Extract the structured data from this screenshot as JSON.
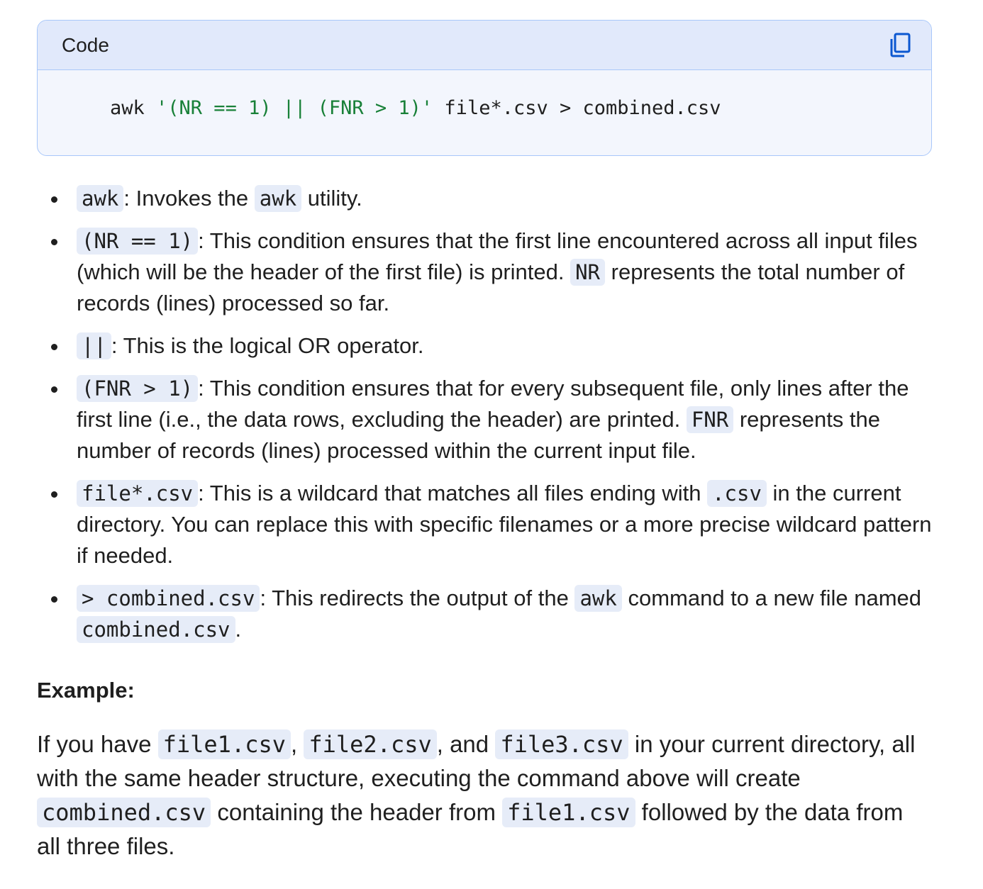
{
  "code_block": {
    "language_label": "Code",
    "copy_icon": "copy-icon",
    "code_prefix": "awk ",
    "code_string": "'(NR == 1) || (FNR > 1)'",
    "code_suffix": " file*.csv > combined.csv"
  },
  "bullets": [
    {
      "code": "awk",
      "text_1": ": Invokes the ",
      "code_2": "awk",
      "text_2": " utility."
    },
    {
      "code": "(NR == 1)",
      "text_1": ": This condition ensures that the first line encountered across all input files (which will be the header of the first file) is printed. ",
      "code_2": "NR",
      "text_2": " represents the total number of records (lines) processed so far."
    },
    {
      "code": "||",
      "text_1": ": This is the logical OR operator."
    },
    {
      "code": "(FNR > 1)",
      "text_1": ": This condition ensures that for every subsequent file, only lines after the first line (i.e., the data rows, excluding the header) are printed. ",
      "code_2": "FNR",
      "text_2": " represents the number of records (lines) processed within the current input file."
    },
    {
      "code": "file*.csv",
      "text_1": ": This is a wildcard that matches all files ending with ",
      "code_2": ".csv",
      "text_2": " in the current directory. You can replace this with specific filenames or a more precise wildcard pattern if needed."
    },
    {
      "code": "> combined.csv",
      "text_1": ": This redirects the output of the ",
      "code_2": "awk",
      "text_2": " command to a new file named ",
      "code_3": "combined.csv",
      "text_3": "."
    }
  ],
  "example": {
    "heading": "Example:",
    "p1": "If you have ",
    "c1": "file1.csv",
    "p2": ", ",
    "c2": "file2.csv",
    "p3": ", and ",
    "c3": "file3.csv",
    "p4": " in your current directory, all with the same header structure, executing the command above will create ",
    "c4": "combined.csv",
    "p5": " containing the header from ",
    "c5": "file1.csv",
    "p6": " followed by the data from all three files."
  }
}
